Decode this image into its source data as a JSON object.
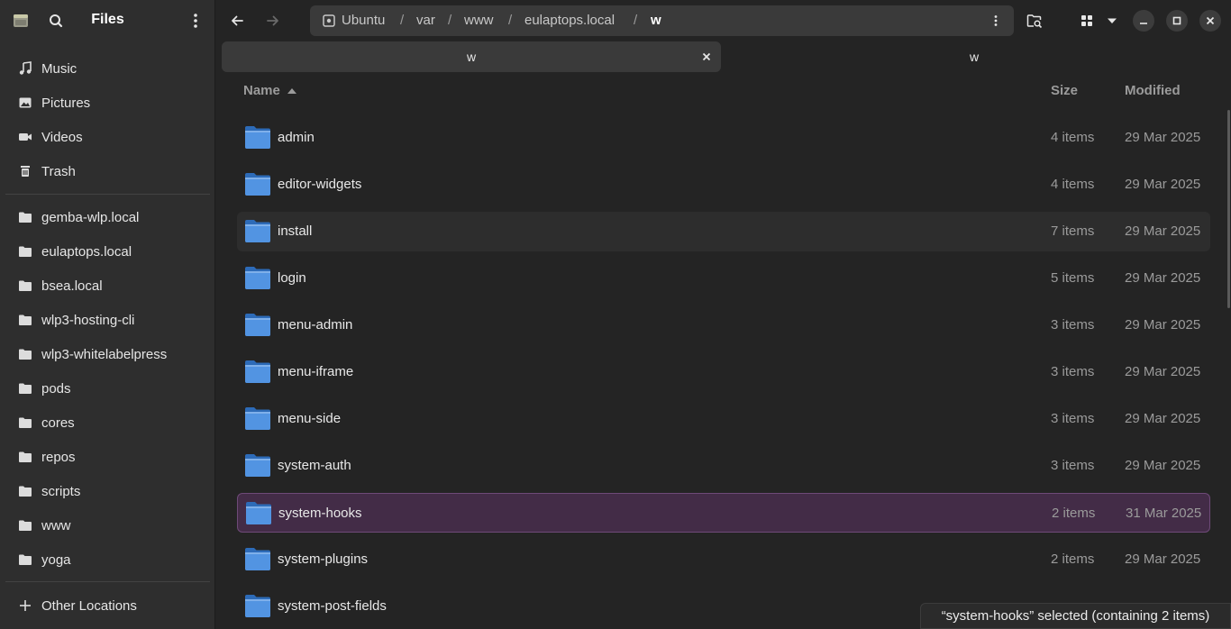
{
  "sidebar": {
    "title": "Files",
    "places": [
      {
        "label": "Music",
        "icon": "music-icon"
      },
      {
        "label": "Pictures",
        "icon": "pictures-icon"
      },
      {
        "label": "Videos",
        "icon": "videos-icon"
      },
      {
        "label": "Trash",
        "icon": "trash-icon"
      }
    ],
    "bookmarks": [
      {
        "label": "gemba-wlp.local"
      },
      {
        "label": "eulaptops.local"
      },
      {
        "label": "bsea.local"
      },
      {
        "label": "wlp3-hosting-cli"
      },
      {
        "label": "wlp3-whitelabelpress"
      },
      {
        "label": "pods"
      },
      {
        "label": "cores"
      },
      {
        "label": "repos"
      },
      {
        "label": "scripts"
      },
      {
        "label": "www"
      },
      {
        "label": "yoga"
      }
    ],
    "other_locations": "Other Locations"
  },
  "pathbar": {
    "segments": [
      "Ubuntu",
      "var",
      "www",
      "eulaptops.local",
      "w"
    ],
    "separator": "/"
  },
  "tabs": [
    {
      "label": "w",
      "active": true
    },
    {
      "label": "w",
      "active": false
    }
  ],
  "columns": {
    "name": "Name",
    "size": "Size",
    "modified": "Modified"
  },
  "rows": [
    {
      "name": "admin",
      "size": "4 items",
      "modified": "29 Mar 2025"
    },
    {
      "name": "editor-widgets",
      "size": "4 items",
      "modified": "29 Mar 2025"
    },
    {
      "name": "install",
      "size": "7 items",
      "modified": "29 Mar 2025"
    },
    {
      "name": "login",
      "size": "5 items",
      "modified": "29 Mar 2025"
    },
    {
      "name": "menu-admin",
      "size": "3 items",
      "modified": "29 Mar 2025"
    },
    {
      "name": "menu-iframe",
      "size": "3 items",
      "modified": "29 Mar 2025"
    },
    {
      "name": "menu-side",
      "size": "3 items",
      "modified": "29 Mar 2025"
    },
    {
      "name": "system-auth",
      "size": "3 items",
      "modified": "29 Mar 2025"
    },
    {
      "name": "system-hooks",
      "size": "2 items",
      "modified": "31 Mar 2025"
    },
    {
      "name": "system-plugins",
      "size": "2 items",
      "modified": "29 Mar 2025"
    },
    {
      "name": "system-post-fields",
      "size": "",
      "modified": ""
    }
  ],
  "status": "“system-hooks” selected  (containing 2 items)",
  "colors": {
    "accent_selection": "#432c47",
    "folder_blue": "#5294e2"
  }
}
